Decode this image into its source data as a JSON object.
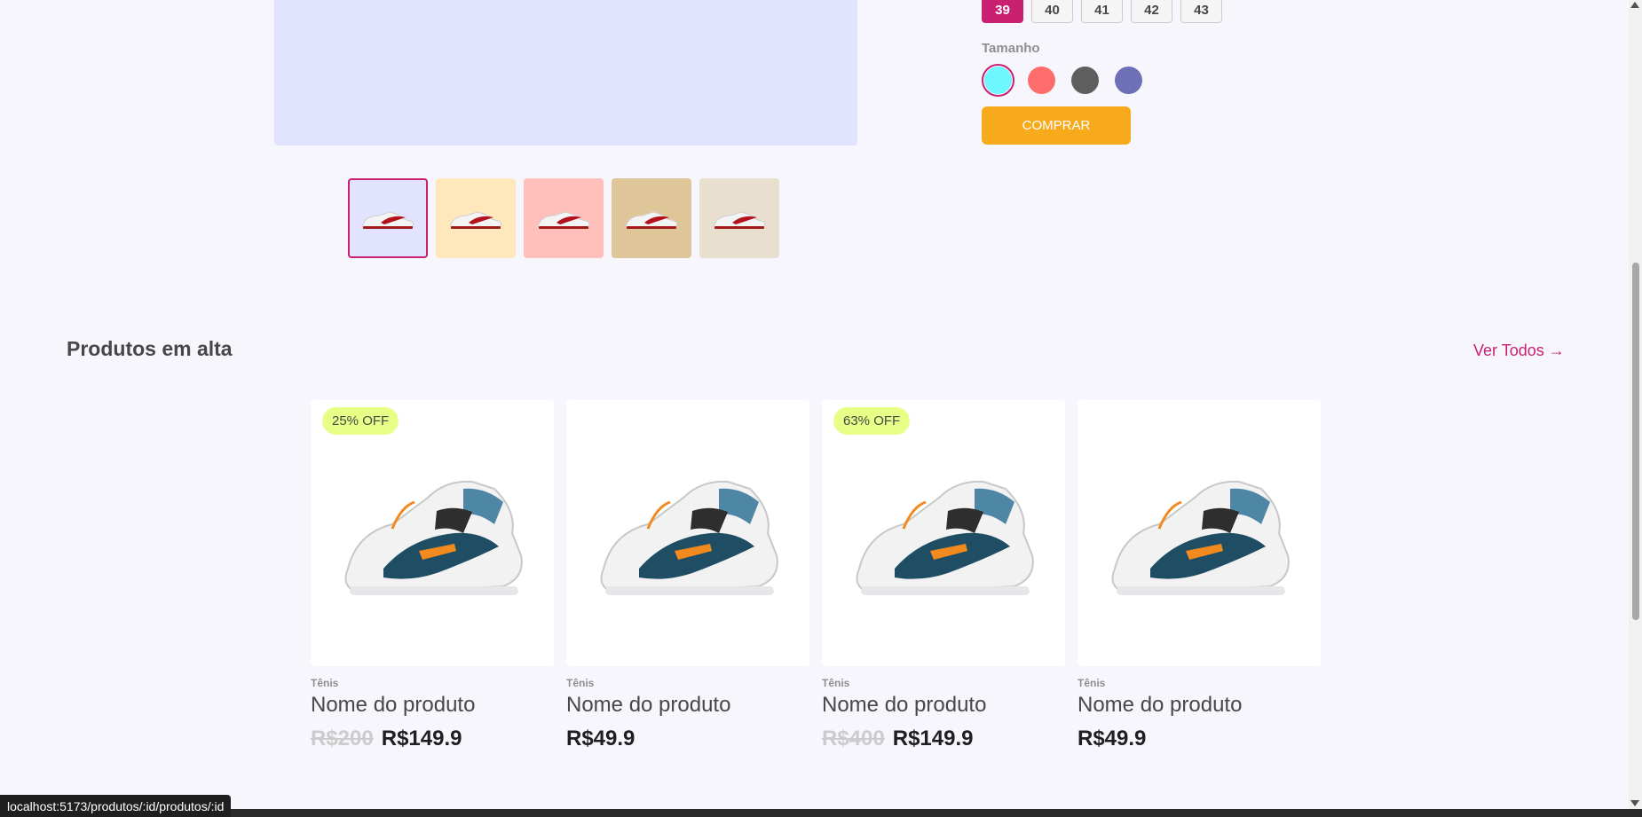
{
  "product": {
    "sizes": [
      {
        "label": "39",
        "active": true
      },
      {
        "label": "40",
        "active": false
      },
      {
        "label": "41",
        "active": false
      },
      {
        "label": "42",
        "active": false
      },
      {
        "label": "43",
        "active": false
      }
    ],
    "color_label": "Tamanho",
    "colors": [
      "#6ff7ff",
      "#ff6c6c",
      "#5e5e5e",
      "#6d70b7"
    ],
    "buy_label": "COMPRAR",
    "thumbnails": [
      "#e2e3ff",
      "#ffe8bc",
      "#ffc0bc",
      "#dec699",
      "#e8dfcf"
    ]
  },
  "trending": {
    "title": "Produtos em alta",
    "see_all": "Ver Todos →",
    "products": [
      {
        "badge": "25% OFF",
        "category": "Tênis",
        "name": "Nome do produto",
        "old_price": "R$200",
        "price": "R$149.9"
      },
      {
        "badge": "",
        "category": "Tênis",
        "name": "Nome do produto",
        "old_price": "",
        "price": "R$49.9"
      },
      {
        "badge": "63% OFF",
        "category": "Tênis",
        "name": "Nome do produto",
        "old_price": "R$400",
        "price": "R$149.9"
      },
      {
        "badge": "",
        "category": "Tênis",
        "name": "Nome do produto",
        "old_price": "",
        "price": "R$49.9"
      }
    ]
  },
  "status_url": "localhost:5173/produtos/:id/produtos/:id"
}
